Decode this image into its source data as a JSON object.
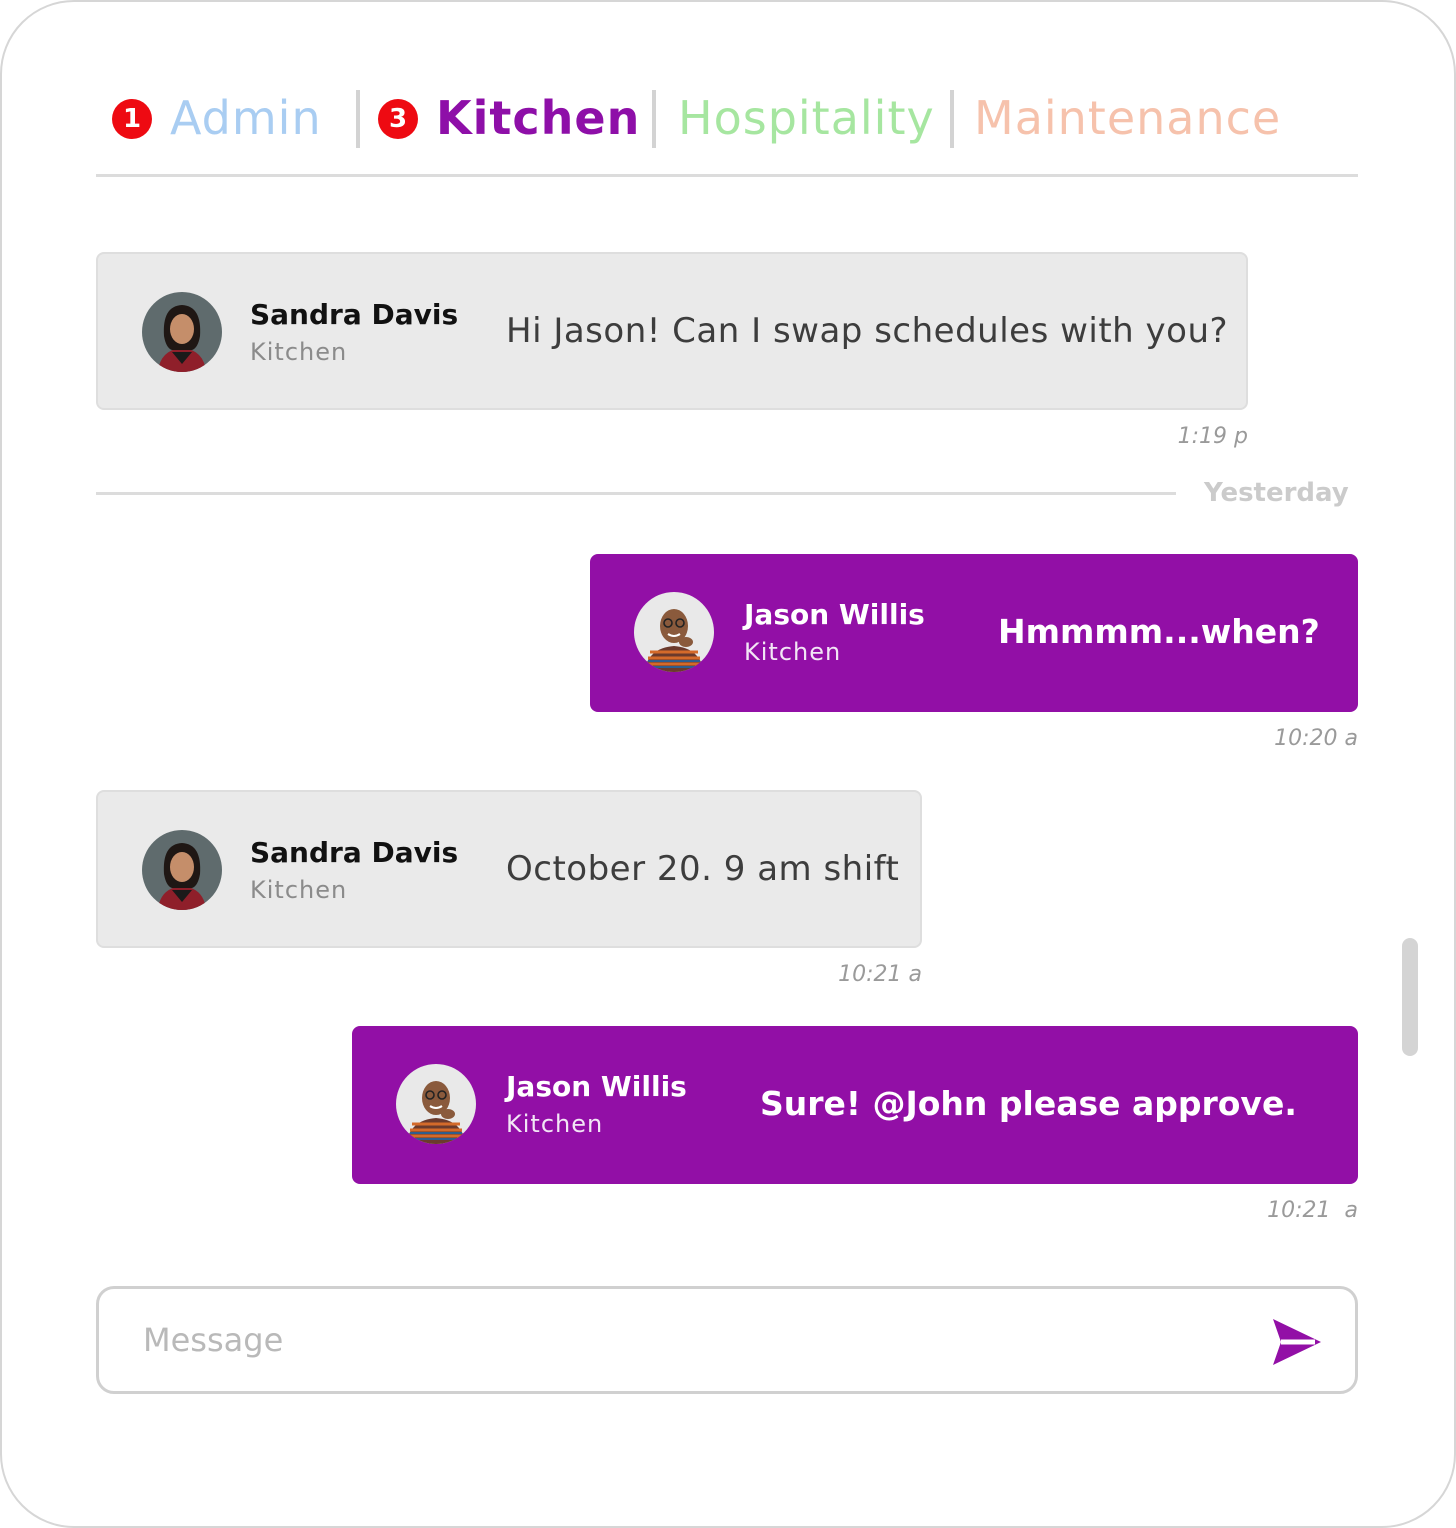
{
  "tabs": [
    {
      "label": "Admin",
      "badge": "1"
    },
    {
      "label": "Kitchen",
      "badge": "3"
    },
    {
      "label": "Hospitality"
    },
    {
      "label": "Maintenance"
    }
  ],
  "messages": [
    {
      "sender": "Sandra Davis",
      "dept": "Kitchen",
      "text": "Hi Jason! Can I swap schedules with you?",
      "time": "1:19 p"
    },
    {
      "sender": "Jason Willis",
      "dept": "Kitchen",
      "text": "Hmmmm...when?",
      "time": "10:20 a"
    },
    {
      "sender": "Sandra Davis",
      "dept": "Kitchen",
      "text": "October 20. 9 am shift",
      "time": "10:21 a"
    },
    {
      "sender": "Jason Willis",
      "dept": "Kitchen",
      "text": "Sure! @John please approve.",
      "time": "10:21  a"
    }
  ],
  "divider": {
    "label": "Yesterday"
  },
  "composer": {
    "placeholder": "Message"
  },
  "colors": {
    "accent": "#920fa6",
    "badge": "#ee0a12",
    "admin": "#a9cdf2",
    "hospitality": "#a6e6a0",
    "maintenance": "#f6c2ac",
    "incoming_bubble": "#eaeaea"
  },
  "icons": {
    "send": "send-icon",
    "avatar_sandra": "avatar-photo",
    "avatar_jason": "avatar-photo"
  }
}
